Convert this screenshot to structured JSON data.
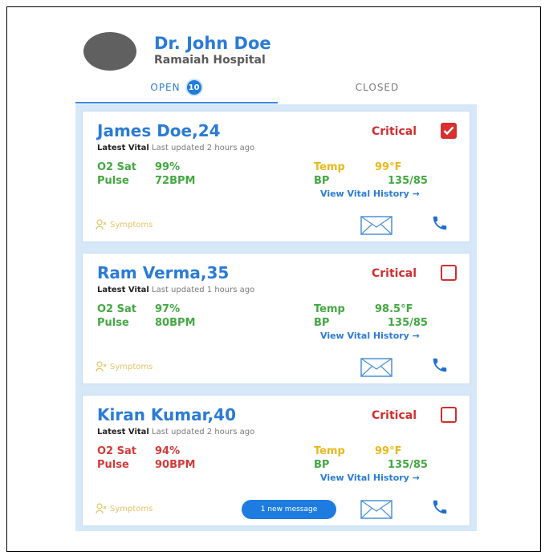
{
  "doctor": {
    "name": "Dr. John Doe",
    "hospital": "Ramaiah Hospital"
  },
  "tabs": {
    "open_label": "OPEN",
    "open_count": "10",
    "closed_label": "CLOSED"
  },
  "colors": {
    "primary": "#2a7bd6",
    "critical": "#cf2f2f",
    "normal": "#43a843",
    "warning": "#e9b81c",
    "list_bg": "#d6e8f8"
  },
  "cards": [
    {
      "name": "James Doe,24",
      "status": "Critical",
      "checked": true,
      "vital_title": "Latest Vital",
      "updated": "Last updated 2 hours ago",
      "o2_label": "O2 Sat",
      "o2_value": "99%",
      "pulse_label": "Pulse",
      "pulse_value": "72BPM",
      "temp_label": "Temp",
      "temp_value": "99°F",
      "bp_label": "BP",
      "bp_value": "135/85",
      "history_link": "View Vital History →",
      "symptoms": "Symptoms",
      "new_message": "",
      "icons": {
        "symptoms": "symptoms-icon",
        "mail": "mail-icon",
        "phone": "phone-icon"
      }
    },
    {
      "name": "Ram Verma,35",
      "status": "Critical",
      "checked": false,
      "vital_title": "Latest Vital",
      "updated": "Last updated 1 hours ago",
      "o2_label": "O2 Sat",
      "o2_value": "97%",
      "pulse_label": "Pulse",
      "pulse_value": "80BPM",
      "temp_label": "Temp",
      "temp_value": "98.5°F",
      "bp_label": "BP",
      "bp_value": "135/85",
      "history_link": "View Vital History →",
      "symptoms": "Symptoms",
      "new_message": "",
      "icons": {
        "symptoms": "symptoms-icon",
        "mail": "mail-icon",
        "phone": "phone-icon"
      }
    },
    {
      "name": "Kiran Kumar,40",
      "status": "Critical",
      "checked": false,
      "vital_title": "Latest Vital",
      "updated": "Last updated 2 hours ago",
      "o2_label": "O2 Sat",
      "o2_value": "94%",
      "pulse_label": "Pulse",
      "pulse_value": "90BPM",
      "temp_label": "Temp",
      "temp_value": "99°F",
      "bp_label": "BP",
      "bp_value": "135/85",
      "history_link": "View Vital History →",
      "symptoms": "Symptoms",
      "new_message": "1 new message",
      "icons": {
        "symptoms": "symptoms-icon",
        "mail": "mail-icon",
        "phone": "phone-icon"
      }
    }
  ]
}
